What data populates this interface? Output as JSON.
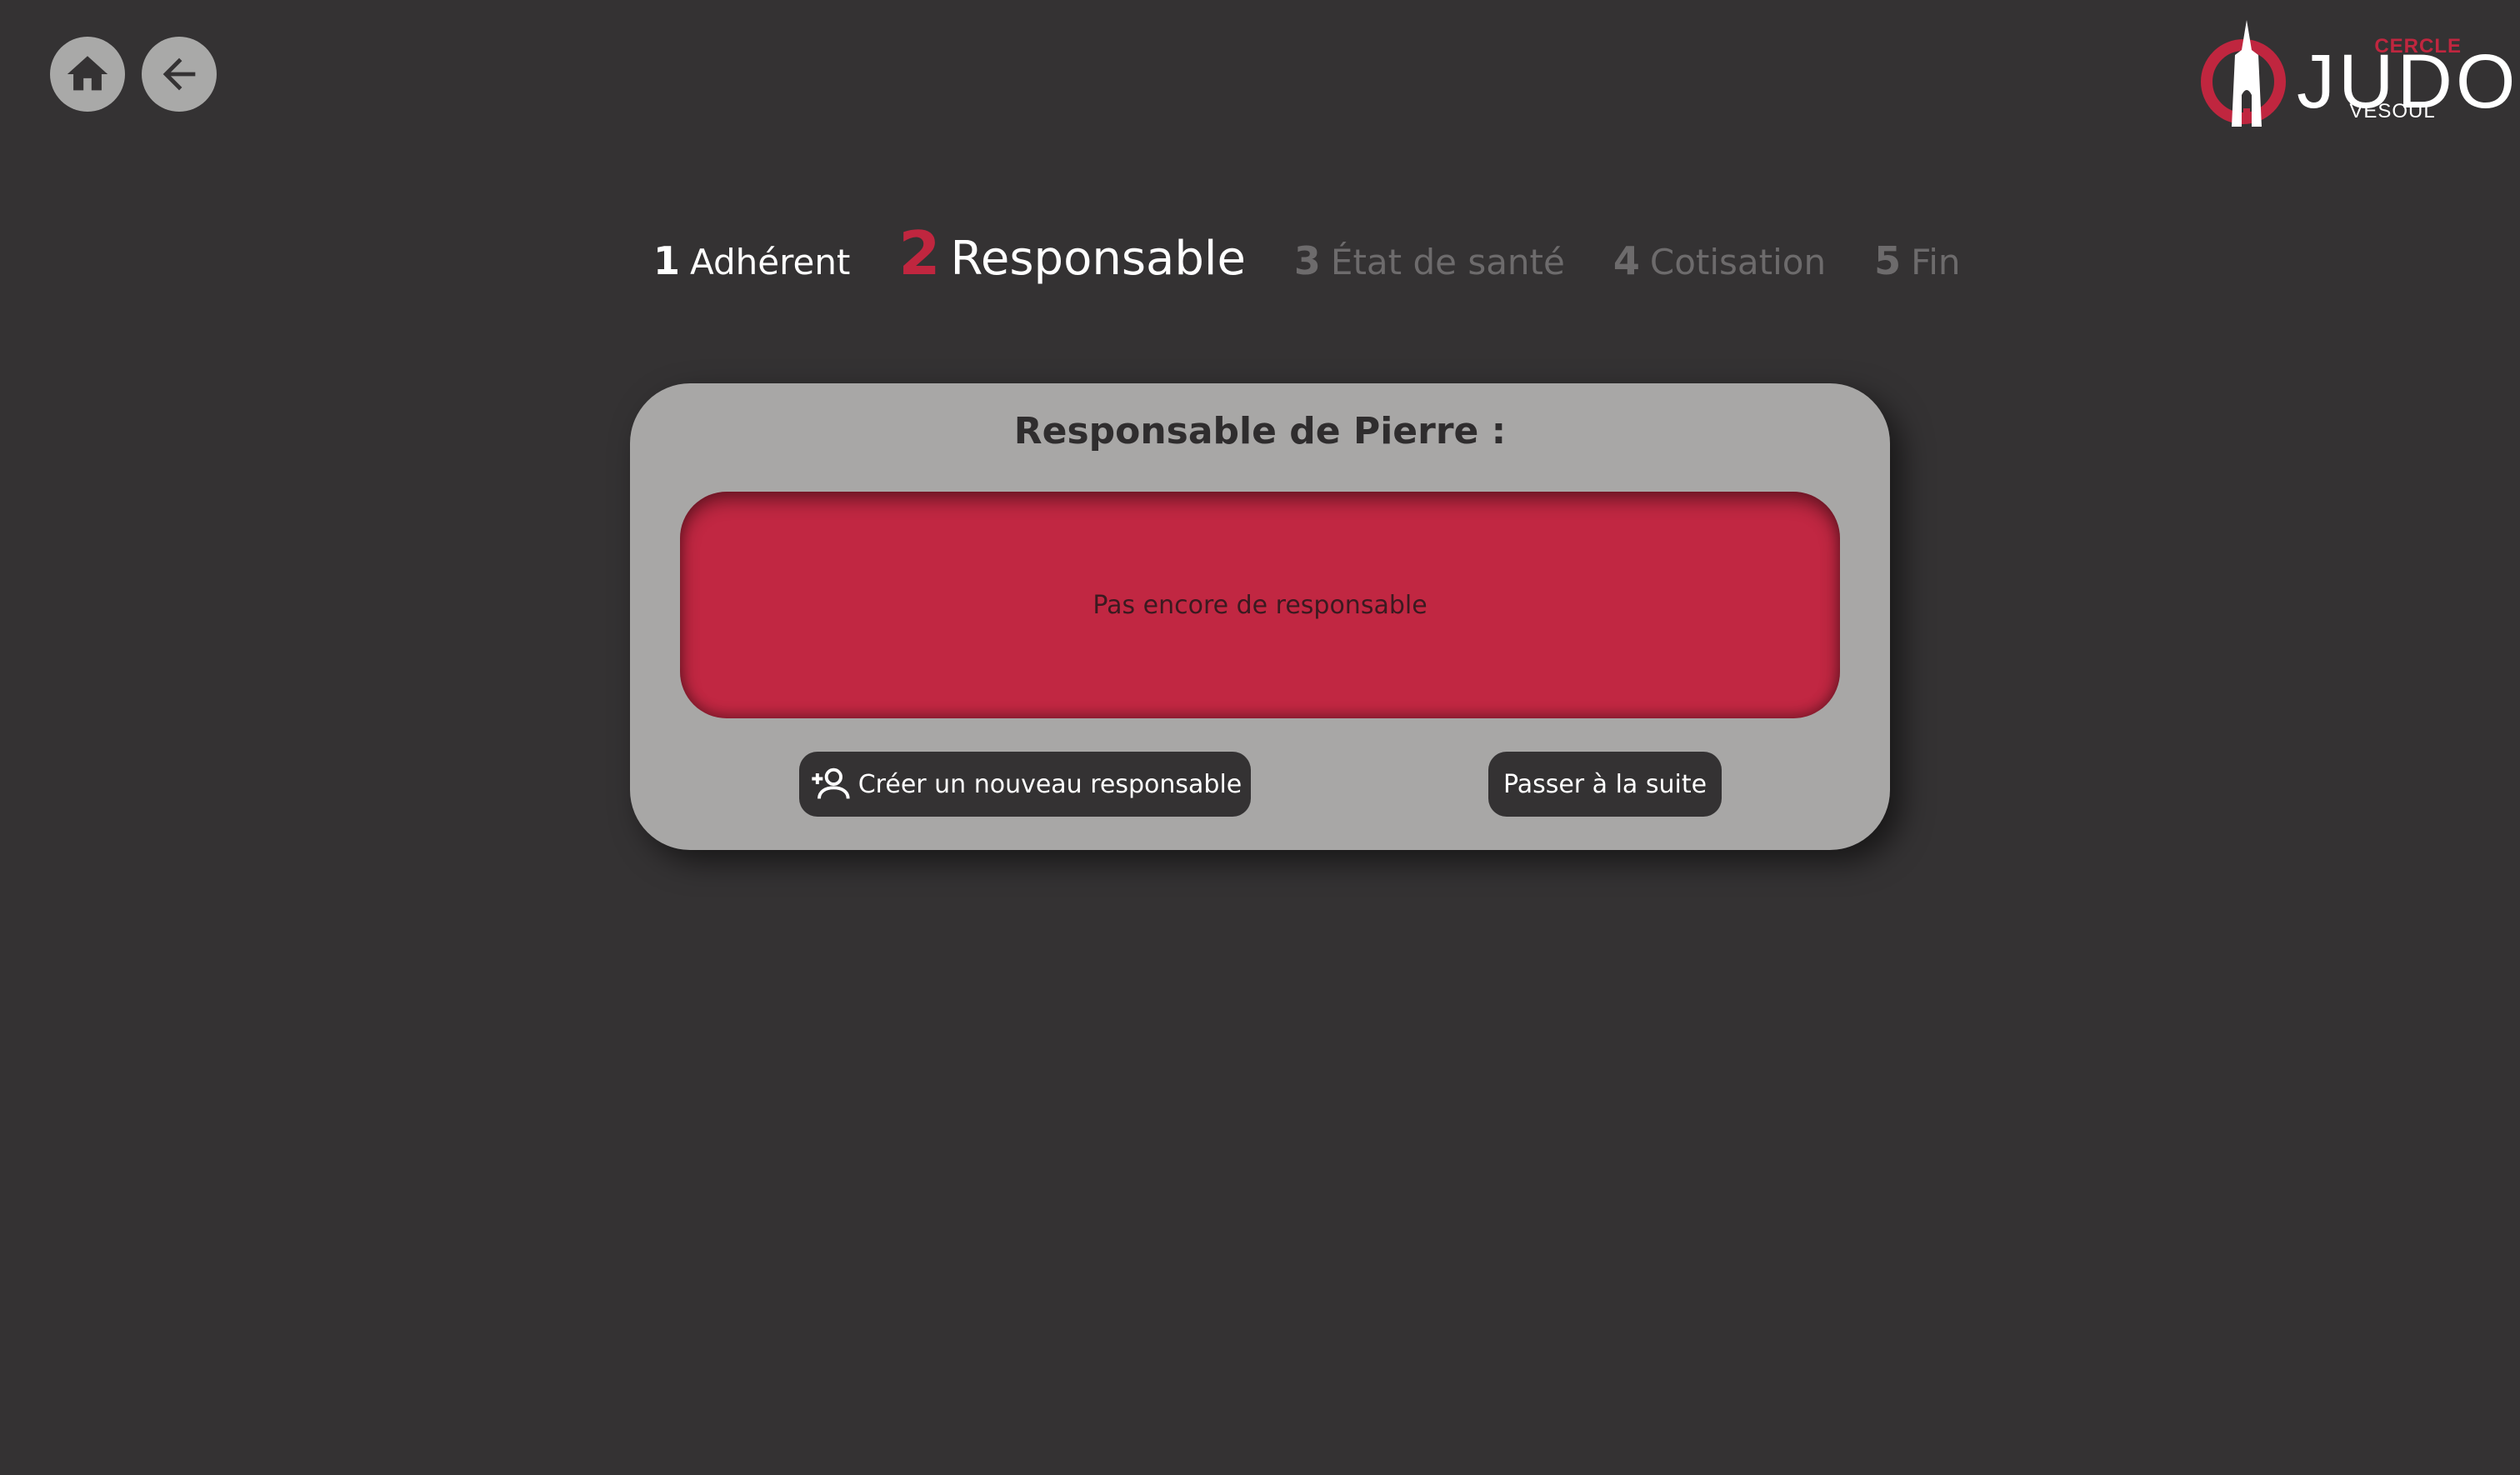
{
  "nav": {
    "home_icon": "home-icon",
    "back_icon": "arrow-left-icon"
  },
  "logo": {
    "line1": "CERCLE",
    "line2": "JUDO",
    "line3": "VESOUL"
  },
  "stepper": {
    "steps": [
      {
        "num": "1",
        "label": "Adhérent",
        "state": "done"
      },
      {
        "num": "2",
        "label": "Responsable",
        "state": "active"
      },
      {
        "num": "3",
        "label": "État de santé",
        "state": "todo"
      },
      {
        "num": "4",
        "label": "Cotisation",
        "state": "todo"
      },
      {
        "num": "5",
        "label": "Fin",
        "state": "todo"
      }
    ]
  },
  "card": {
    "title": "Responsable de Pierre :",
    "empty_message": "Pas encore de responsable",
    "create_button": "Créer un nouveau responsable",
    "create_icon": "person-add-icon",
    "next_button": "Passer à la suite"
  },
  "colors": {
    "background": "#343233",
    "card": "#a8a7a6",
    "accent": "#c0263f",
    "inactive_step": "#6d6b6c"
  }
}
